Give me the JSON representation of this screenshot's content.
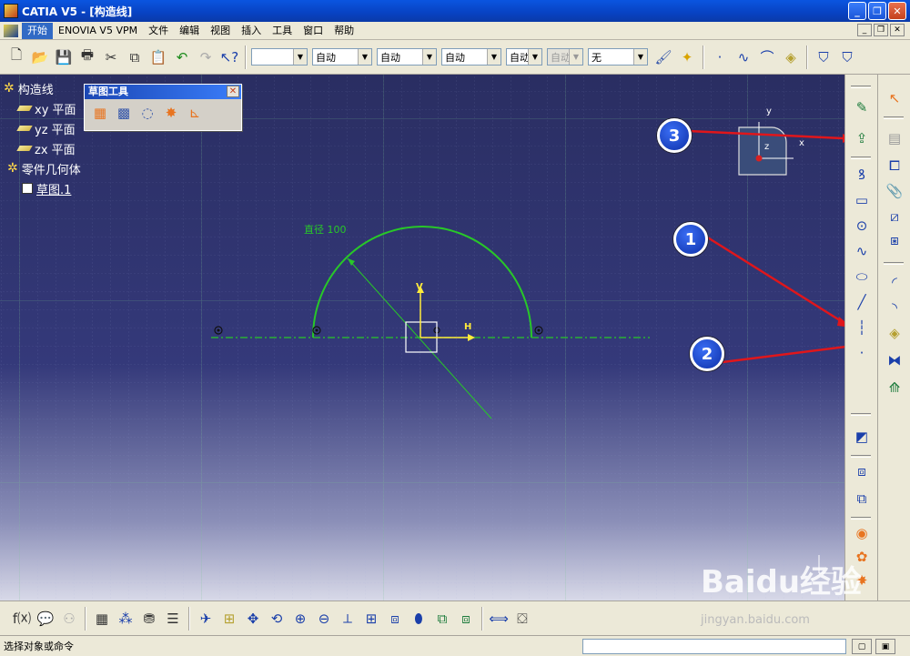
{
  "window": {
    "title": "CATIA V5 - [构造线]",
    "min": "_",
    "max": "❐",
    "close": "✕"
  },
  "menu": {
    "items": [
      "开始",
      "ENOVIA V5 VPM",
      "文件",
      "编辑",
      "视图",
      "插入",
      "工具",
      "窗口",
      "帮助"
    ]
  },
  "toolbar": {
    "combos": [
      "",
      "自动",
      "自动",
      "自动",
      "自动",
      "自动",
      "无"
    ]
  },
  "tree": {
    "root": "构造线",
    "planes": [
      "xy 平面",
      "yz 平面",
      "zx 平面"
    ],
    "body": "零件几何体",
    "sketch": "草图.1"
  },
  "sketch_tools_panel": {
    "title": "草图工具",
    "close": "✕"
  },
  "sketch": {
    "dimension_label": "直径 100",
    "axis_v": "V",
    "axis_h": "H"
  },
  "compass": {
    "x": "x",
    "y": "y",
    "z": "z"
  },
  "callouts": [
    "1",
    "2",
    "3"
  ],
  "status": {
    "prompt": "选择对象或命令"
  },
  "watermark": {
    "text": "Baidu经验",
    "url": "jingyan.baidu.com"
  },
  "colors": {
    "sketch_green": "#28c828",
    "axis_yellow": "#ffeb3b",
    "arrow_red": "#e0161b",
    "callout_blue": "#1e44d6"
  }
}
